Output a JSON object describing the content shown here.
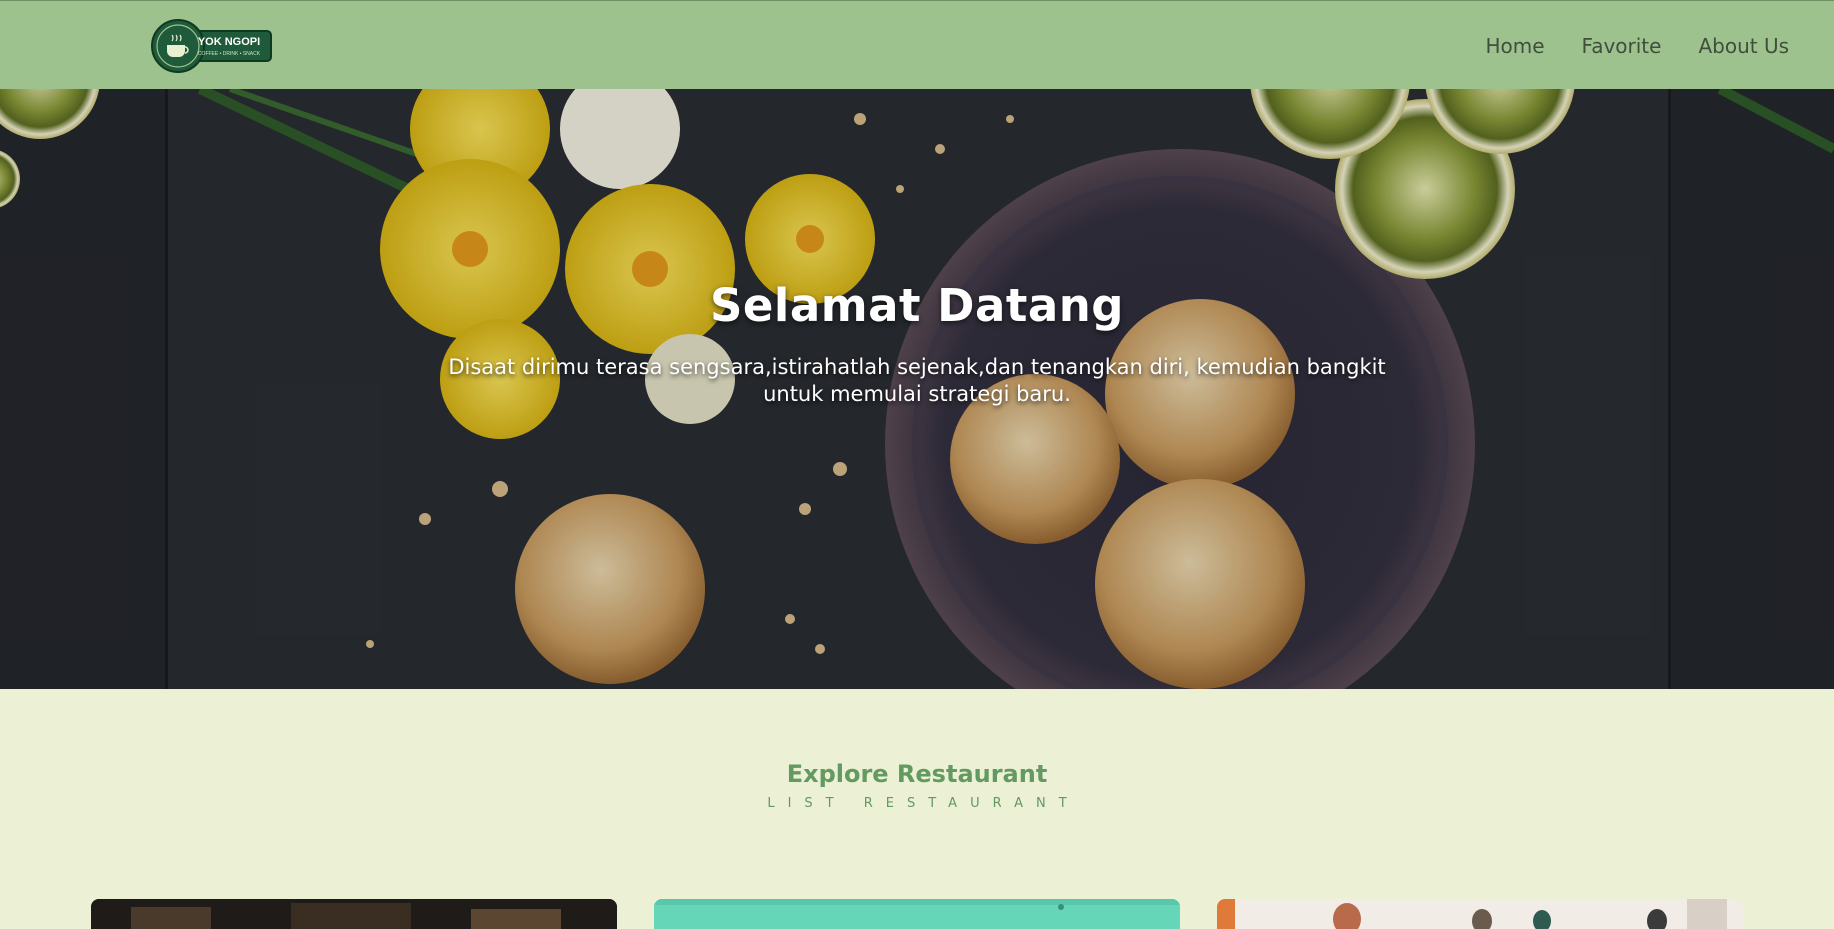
{
  "navbar": {
    "logo": {
      "text": "YOK NGOPI",
      "tagline": "COFFEE • DRINK • SNACK"
    },
    "links": [
      {
        "label": "Home"
      },
      {
        "label": "Favorite"
      },
      {
        "label": "About Us"
      }
    ]
  },
  "hero": {
    "title": "Selamat Datang",
    "subtitle": "Disaat dirimu terasa sengsara,istirahatlah sejenak,dan tenangkan diri, kemudian bangkit untuk memulai strategi baru."
  },
  "explore": {
    "title": "Explore Restaurant",
    "subtitle": "LIST RESTAURANT"
  },
  "colors": {
    "navbar": "#9dc28e",
    "page_background": "#ecf0d4",
    "accent_green": "#629a62"
  }
}
